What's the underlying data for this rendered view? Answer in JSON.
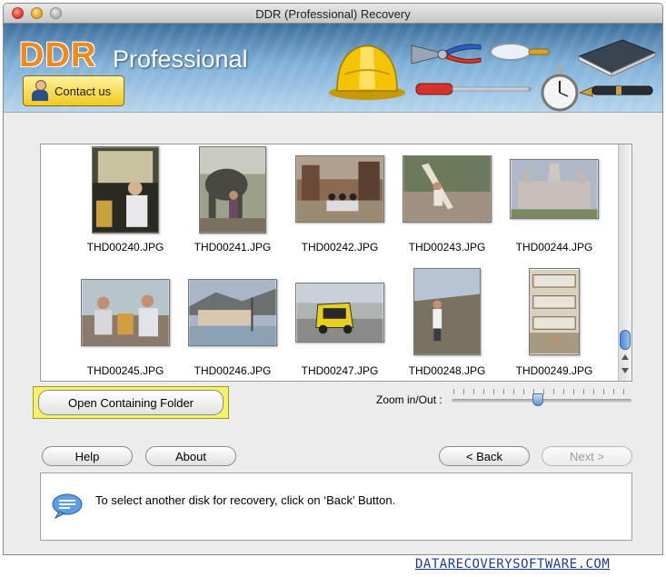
{
  "window": {
    "title": "DDR (Professional) Recovery"
  },
  "banner": {
    "logo_ddr": "DDR",
    "logo_professional": "Professional",
    "contact_label": "Contact us"
  },
  "thumbnails": [
    {
      "name": "THD00240.JPG"
    },
    {
      "name": "THD00241.JPG"
    },
    {
      "name": "THD00242.JPG"
    },
    {
      "name": "THD00243.JPG"
    },
    {
      "name": "THD00244.JPG"
    },
    {
      "name": "THD00245.JPG"
    },
    {
      "name": "THD00246.JPG"
    },
    {
      "name": "THD00247.JPG"
    },
    {
      "name": "THD00248.JPG"
    },
    {
      "name": "THD00249.JPG"
    }
  ],
  "actions": {
    "open_folder_label": "Open Containing Folder",
    "zoom_label": "Zoom in/Out :"
  },
  "zoom": {
    "level": 0.48
  },
  "nav": {
    "help_label": "Help",
    "about_label": "About",
    "back_label": "< Back",
    "next_label": "Next >"
  },
  "status": {
    "message": "To select another disk for recovery, click on ‘Back’ Button."
  },
  "footer": {
    "link": "DATARECOVERYSOFTWARE.COM"
  },
  "colors": {
    "accent_orange": "#f08a1c",
    "highlight_yellow": "#f6f06a",
    "banner_blue": "#5a8fc0"
  }
}
